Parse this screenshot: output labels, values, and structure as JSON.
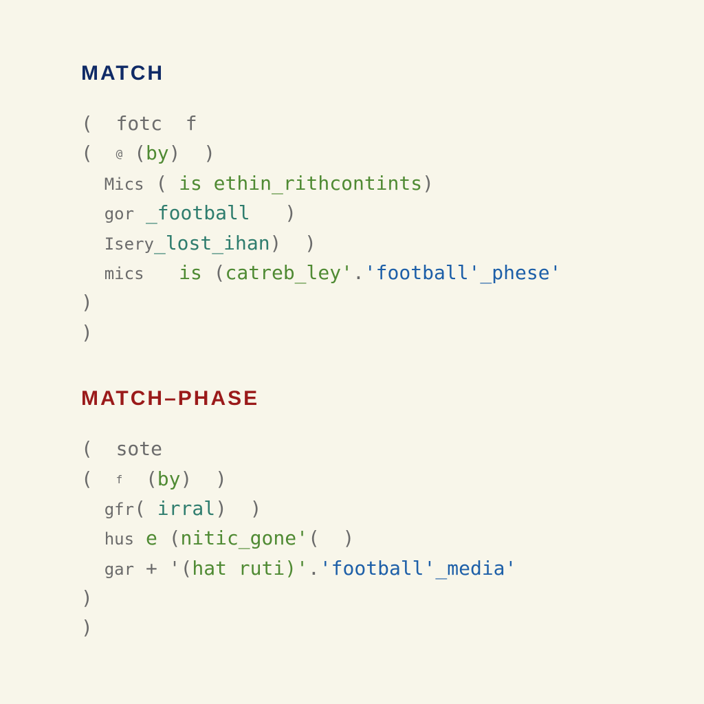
{
  "sections": {
    "match": {
      "heading": "MATCH",
      "lines": {
        "l1": {
          "a": "(",
          "b": "fotc",
          "c": "f"
        },
        "l2": {
          "a": "(",
          "b": "@",
          "c": "(",
          "d": "by",
          "e": ")",
          "f": ")"
        },
        "l3": {
          "a": "Mics",
          "b": "(",
          "c": "is",
          "d": "ethin_rithcontints",
          "e": ")"
        },
        "l4": {
          "a": "gor",
          "b": "_",
          "c": "football",
          "d": ")"
        },
        "l5": {
          "a": "Isery",
          "b": "_",
          "c": "lost_ihan",
          "d": ")",
          "e": ")"
        },
        "l6": {
          "a": "mics",
          "b": "is",
          "c": "(",
          "d": "catreb_ley'",
          "e": ".",
          "f": "'football'_phese'"
        },
        "l7": {
          "a": ")"
        },
        "l8": {
          "a": ")"
        }
      }
    },
    "matchPhase": {
      "heading": "MATCH–PHASE",
      "lines": {
        "l1": {
          "a": "(",
          "b": "sote"
        },
        "l2": {
          "a": "(",
          "b": "f",
          "c": "(",
          "d": "by",
          "e": ")",
          "f": ")"
        },
        "l3": {
          "a": "gfr",
          "b": "(",
          "c": "irral",
          "d": ")",
          "e": ")"
        },
        "l4": {
          "a": "hus",
          "b": "e",
          "c": "(",
          "d": "nitic_gone'",
          "e": "(",
          "f": ")"
        },
        "l5": {
          "a": "gar",
          "b": "+",
          "c": "'(",
          "d": "hat ruti)'",
          "e": ".",
          "f": "'football'_media'"
        },
        "l6": {
          "a": ")"
        },
        "l7": {
          "a": ")"
        }
      }
    }
  }
}
